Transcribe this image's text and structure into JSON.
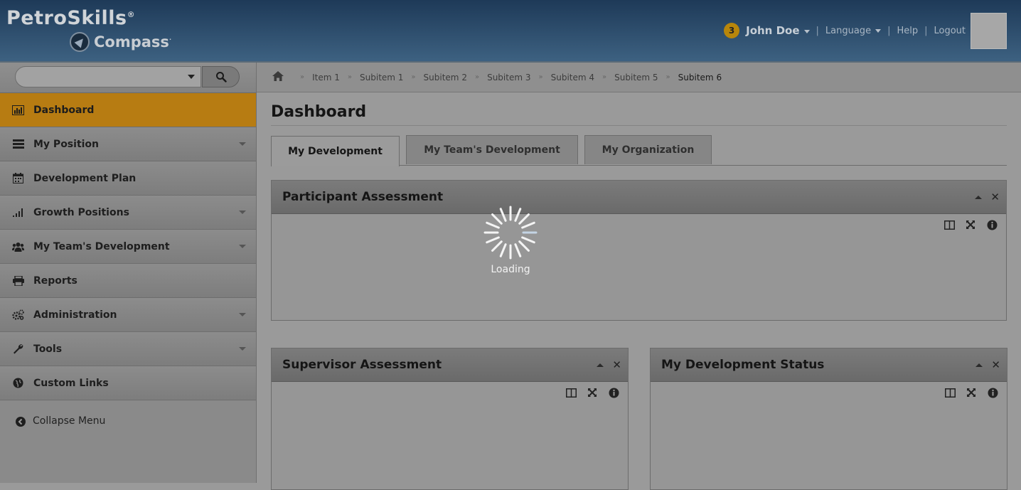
{
  "header": {
    "brand": "PetroSkills",
    "brand_mark": "®",
    "product": "Compass",
    "product_mark": "·",
    "notification_count": "3",
    "user_name": "John Doe",
    "language_label": "Language",
    "help_label": "Help",
    "logout_label": "Logout",
    "separator": "|"
  },
  "sidebar": {
    "search": {
      "placeholder": ""
    },
    "items": [
      {
        "label": "Dashboard",
        "icon": "bar-chart-icon",
        "active": true,
        "expandable": false
      },
      {
        "label": "My Position",
        "icon": "list-icon",
        "active": false,
        "expandable": true
      },
      {
        "label": "Development Plan",
        "icon": "calendar-icon",
        "active": false,
        "expandable": false
      },
      {
        "label": "Growth Positions",
        "icon": "signal-icon",
        "active": false,
        "expandable": true
      },
      {
        "label": "My Team's Development",
        "icon": "users-icon",
        "active": false,
        "expandable": true
      },
      {
        "label": "Reports",
        "icon": "print-icon",
        "active": false,
        "expandable": false
      },
      {
        "label": "Administration",
        "icon": "gears-icon",
        "active": false,
        "expandable": true
      },
      {
        "label": "Tools",
        "icon": "wrench-icon",
        "active": false,
        "expandable": true
      },
      {
        "label": "Custom Links",
        "icon": "globe-icon",
        "active": false,
        "expandable": false
      }
    ],
    "collapse_label": "Collapse Menu"
  },
  "breadcrumb": {
    "items": [
      "Item 1",
      "Subitem 1",
      "Subitem 2",
      "Subitem 3",
      "Subitem 4",
      "Subitem 5",
      "Subitem 6"
    ],
    "separator": "»"
  },
  "main": {
    "title": "Dashboard",
    "tabs": [
      {
        "label": "My Development",
        "active": true
      },
      {
        "label": "My Team's Development",
        "active": false
      },
      {
        "label": "My Organization",
        "active": false
      }
    ],
    "panels": {
      "participant": {
        "title": "Participant Assessment"
      },
      "supervisor": {
        "title": "Supervisor Assessment"
      },
      "status": {
        "title": "My Development Status"
      }
    },
    "panel_close": "✕",
    "loading_text": "Loading"
  },
  "colors": {
    "active_nav": "#b77c12",
    "header_gradient_top": "#1e3a58",
    "badge": "#b8860b",
    "overlay_gray": "#9a9a9a"
  }
}
